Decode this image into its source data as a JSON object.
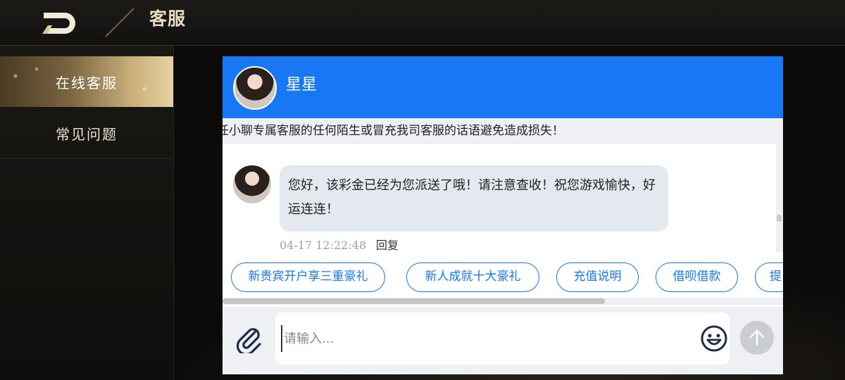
{
  "topbar": {
    "title": "客服",
    "back_icon": "back-logo-icon"
  },
  "sidebar": {
    "items": [
      {
        "label": "在线客服",
        "active": true
      },
      {
        "label": "常见问题",
        "active": false
      }
    ]
  },
  "chat": {
    "header": {
      "agent_name": "星星"
    },
    "notice": "任小聊专属客服的任何陌生或冒充我司客服的话语避免造成损失！",
    "messages": [
      {
        "text": "您好，该彩金已经为您派送了哦！请注意查收！祝您游戏愉快，好运连连！",
        "time": "04-17 12:22:48",
        "reply_label": "回复"
      }
    ],
    "quick_replies": [
      "新贵宾开户享三重豪礼",
      "新人成就十大豪礼",
      "充值说明",
      "借呗借款",
      "提"
    ],
    "input": {
      "placeholder": "请输入...",
      "value": ""
    },
    "icons": {
      "attach": "paperclip-icon",
      "emoji": "smiley-icon",
      "send": "arrow-up-icon"
    }
  },
  "colors": {
    "accent": "#1877f2",
    "gold": "#c8ad77",
    "background": "#0c0b0a",
    "send_disabled": "#c9ccd1"
  }
}
